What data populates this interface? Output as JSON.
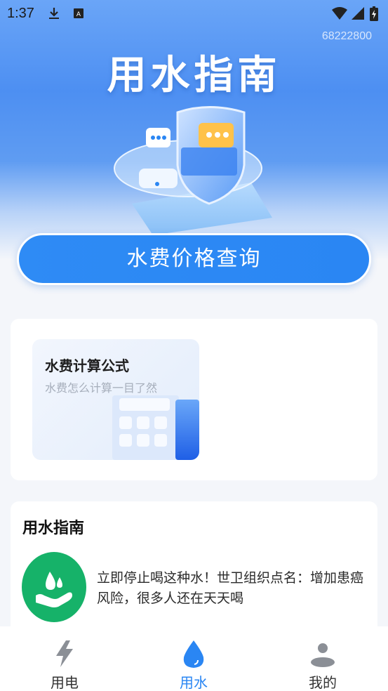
{
  "status_bar": {
    "time": "1:37",
    "icons": [
      "download-icon",
      "keyboard-icon",
      "wifi-icon",
      "signal-icon",
      "battery-icon"
    ]
  },
  "header": {
    "counter": "68222800",
    "title": "用水指南"
  },
  "query_button": {
    "label": "水费价格查询"
  },
  "formula_card": {
    "title": "水费计算公式",
    "subtitle": "水费怎么计算一目了然",
    "icon": "calculator-icon"
  },
  "guide": {
    "section_title": "用水指南",
    "items": [
      {
        "icon": "water-hand-icon",
        "text": "立即停止喝这种水！世卫组织点名：增加患癌风险，很多人还在天天喝"
      }
    ]
  },
  "tabbar": {
    "tabs": [
      {
        "label": "用电",
        "icon": "lightning-icon",
        "active": false
      },
      {
        "label": "用水",
        "icon": "water-drop-icon",
        "active": true
      },
      {
        "label": "我的",
        "icon": "user-icon",
        "active": false
      }
    ]
  },
  "colors": {
    "accent": "#2a86f3",
    "guide_icon_bg": "#16b269",
    "inactive_tab": "#333333"
  }
}
